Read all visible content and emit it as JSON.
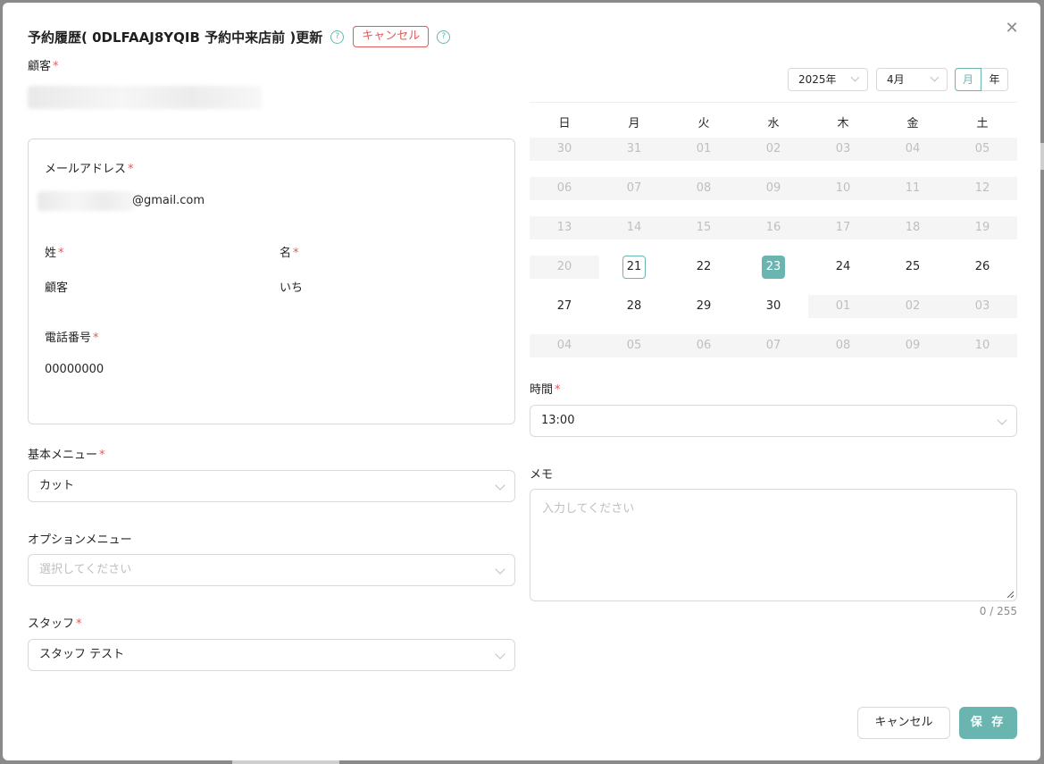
{
  "dialog": {
    "title": "予約履歴( 0DLFAAJ8YQIB 予約中来店前 )更新",
    "status_badge": "キャンセル",
    "close_icon": "close-icon"
  },
  "customer": {
    "label": "顧客",
    "required": "*"
  },
  "card": {
    "email_label": "メールアドレス",
    "email_value": "@gmail.com",
    "last_name_label": "姓",
    "last_name_value": "顧客",
    "first_name_label": "名",
    "first_name_value": "いち",
    "phone_label": "電話番号",
    "phone_value": "00000000"
  },
  "basic_menu": {
    "label": "基本メニュー",
    "value": "カット"
  },
  "option_menu": {
    "label": "オプションメニュー",
    "placeholder": "選択してください"
  },
  "staff": {
    "label": "スタッフ",
    "value": "スタッフ テスト"
  },
  "calendar": {
    "year": "2025年",
    "month": "4月",
    "mode_month": "月",
    "mode_year": "年",
    "mode_selected": "月",
    "weekdays": [
      "日",
      "月",
      "火",
      "水",
      "木",
      "金",
      "土"
    ],
    "today": "21",
    "selected": "23",
    "weeks": [
      [
        [
          "30",
          0
        ],
        [
          "31",
          0
        ],
        [
          "01",
          0
        ],
        [
          "02",
          0
        ],
        [
          "03",
          0
        ],
        [
          "04",
          0
        ],
        [
          "05",
          0
        ]
      ],
      [
        [
          "06",
          0
        ],
        [
          "07",
          0
        ],
        [
          "08",
          0
        ],
        [
          "09",
          0
        ],
        [
          "10",
          0
        ],
        [
          "11",
          0
        ],
        [
          "12",
          0
        ]
      ],
      [
        [
          "13",
          0
        ],
        [
          "14",
          0
        ],
        [
          "15",
          0
        ],
        [
          "16",
          0
        ],
        [
          "17",
          0
        ],
        [
          "18",
          0
        ],
        [
          "19",
          0
        ]
      ],
      [
        [
          "20",
          0
        ],
        [
          "21",
          1
        ],
        [
          "22",
          1
        ],
        [
          "23",
          1
        ],
        [
          "24",
          1
        ],
        [
          "25",
          1
        ],
        [
          "26",
          1
        ]
      ],
      [
        [
          "27",
          1
        ],
        [
          "28",
          1
        ],
        [
          "29",
          1
        ],
        [
          "30",
          1
        ],
        [
          "01",
          0
        ],
        [
          "02",
          0
        ],
        [
          "03",
          0
        ]
      ],
      [
        [
          "04",
          0
        ],
        [
          "05",
          0
        ],
        [
          "06",
          0
        ],
        [
          "07",
          0
        ],
        [
          "08",
          0
        ],
        [
          "09",
          0
        ],
        [
          "10",
          0
        ]
      ]
    ]
  },
  "time": {
    "label": "時間",
    "value": "13:00"
  },
  "memo": {
    "label": "メモ",
    "placeholder": "入力してください",
    "counter": "0 / 255"
  },
  "footer": {
    "cancel_label": "キャンセル",
    "save_label": "保 存"
  },
  "colors": {
    "accent": "#6bb5b0",
    "danger": "#e05b5b"
  }
}
